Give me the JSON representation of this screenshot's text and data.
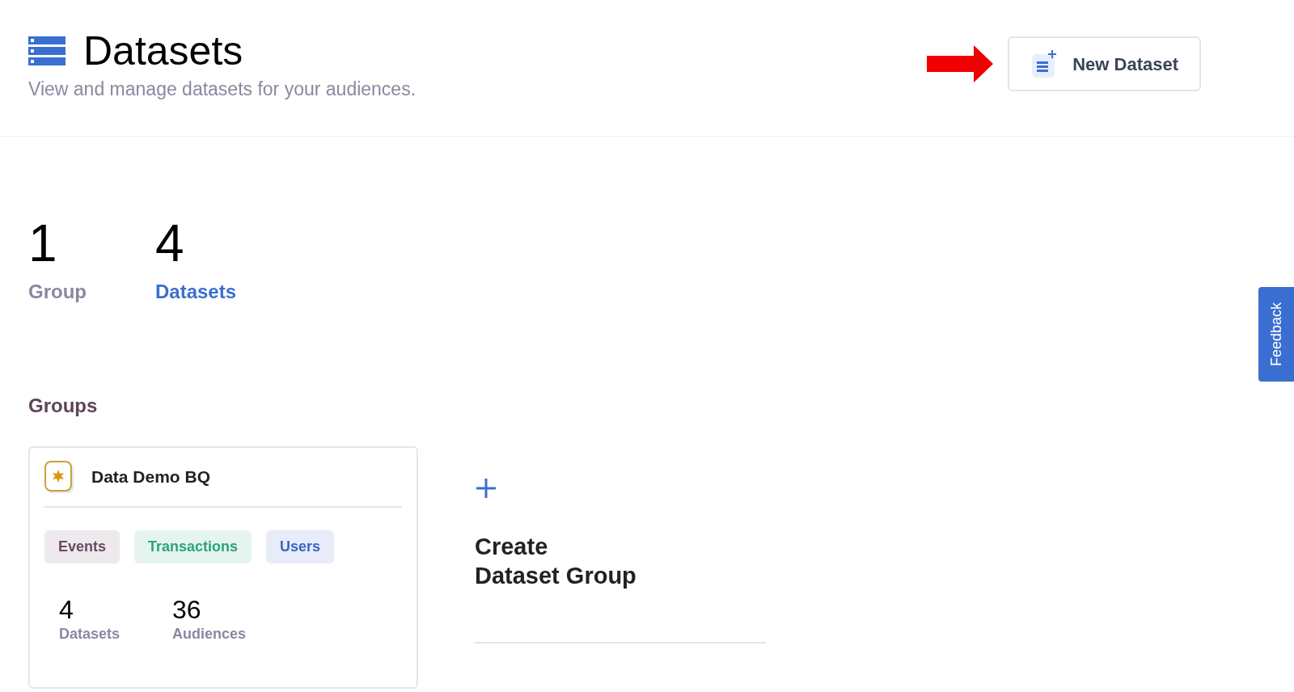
{
  "header": {
    "title": "Datasets",
    "subtitle": "View and manage datasets for your audiences.",
    "new_button": "New Dataset"
  },
  "stats": [
    {
      "value": "1",
      "label": "Group",
      "selected": false
    },
    {
      "value": "4",
      "label": "Datasets",
      "selected": true
    }
  ],
  "groups_heading": "Groups",
  "group_cards": [
    {
      "name": "Data Demo BQ",
      "tags": [
        {
          "label": "Events",
          "color": "#6b4a62"
        },
        {
          "label": "Transactions",
          "color": "#2aa57a"
        },
        {
          "label": "Users",
          "color": "#3a64c8"
        }
      ],
      "metrics": [
        {
          "value": "4",
          "label": "Datasets"
        },
        {
          "value": "36",
          "label": "Audiences"
        }
      ]
    }
  ],
  "create_group": "Create\nDataset Group",
  "feedback": "Feedback"
}
